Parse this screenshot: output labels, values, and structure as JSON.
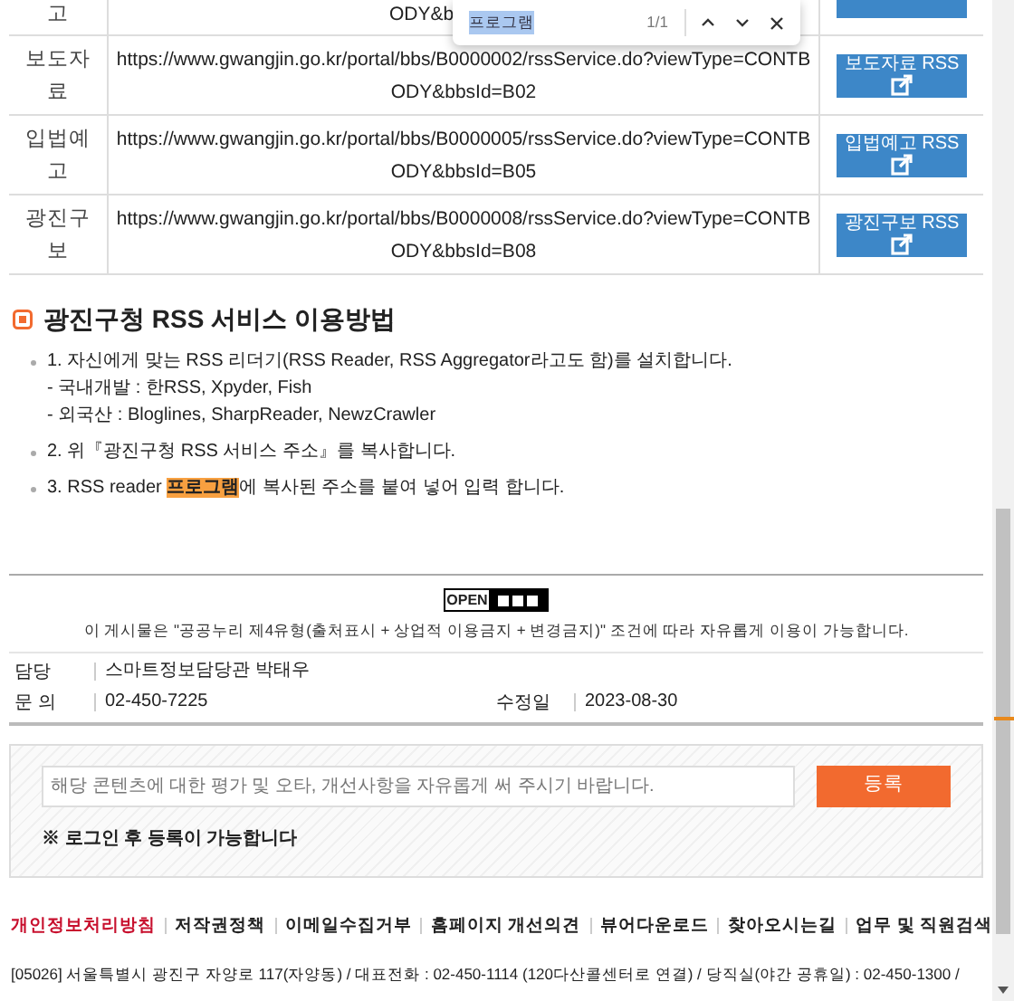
{
  "find_bar": {
    "query": "프로그램",
    "count": "1/1"
  },
  "rss_table": {
    "rows": [
      {
        "name": "고",
        "url": "ODY&b",
        "button": ""
      },
      {
        "name": "보도자료",
        "url": "https://www.gwangjin.go.kr/portal/bbs/B0000002/rssService.do?viewType=CONTBODY&bbsId=B02",
        "button": "보도자료 RSS"
      },
      {
        "name": "입법예고",
        "url": "https://www.gwangjin.go.kr/portal/bbs/B0000005/rssService.do?viewType=CONTBODY&bbsId=B05",
        "button": "입법예고 RSS"
      },
      {
        "name": "광진구보",
        "url": "https://www.gwangjin.go.kr/portal/bbs/B0000008/rssService.do?viewType=CONTBODY&bbsId=B08",
        "button": "광진구보 RSS"
      }
    ]
  },
  "guide": {
    "title": "광진구청 RSS 서비스 이용방법",
    "steps": [
      {
        "text": "1. 자신에게 맞는 RSS 리더기(RSS Reader, RSS Aggregator라고도 함)를 설치합니다.",
        "notes": [
          "- 국내개발 : 한RSS, Xpyder, Fish",
          "- 외국산 : Bloglines, SharpReader, NewzCrawler"
        ]
      },
      {
        "text": "2. 위『광진구청 RSS 서비스 주소』를 복사합니다."
      },
      {
        "text": "3. RSS reader ",
        "highlight": "프로그램",
        "text_after": "에 복사된 주소를 붙여 넣어 입력 합니다."
      }
    ]
  },
  "license": {
    "logo_text": "OPEN",
    "caption": "이 게시물은 \"공공누리 제4유형(출처표시 + 상업적 이용금지 + 변경금지)\" 조건에 따라 자유롭게 이용이 가능합니다."
  },
  "info": {
    "manager_label": "담당",
    "manager": "스마트정보담당관 박태우",
    "contact_label": "문 의",
    "contact": "02-450-7225",
    "updated_label": "수정일",
    "updated": "2023-08-30"
  },
  "feedback": {
    "placeholder": "해당 콘텐츠에 대한 평가 및 오타, 개선사항을 자유롭게 써 주시기 바랍니다.",
    "submit": "등록",
    "note": "※ 로그인 후 등록이 가능합니다"
  },
  "footer_links": [
    {
      "label": "개인정보처리방침",
      "kind": "highlight"
    },
    {
      "label": "저작권정책",
      "kind": "normal"
    },
    {
      "label": "이메일수집거부",
      "kind": "normal"
    },
    {
      "label": "홈페이지 개선의견",
      "kind": "normal"
    },
    {
      "label": "뷰어다운로드",
      "kind": "normal"
    },
    {
      "label": "찾아오시는길",
      "kind": "normal"
    },
    {
      "label": "업무 및 직원검색",
      "kind": "normal"
    }
  ],
  "address": "[05026] 서울특별시 광진구 자양로 117(자양동) / 대표전화 : 02-450-1114 (120다산콜센터로 연결) / 당직실(야간 공휴일) : 02-450-1300 /"
}
